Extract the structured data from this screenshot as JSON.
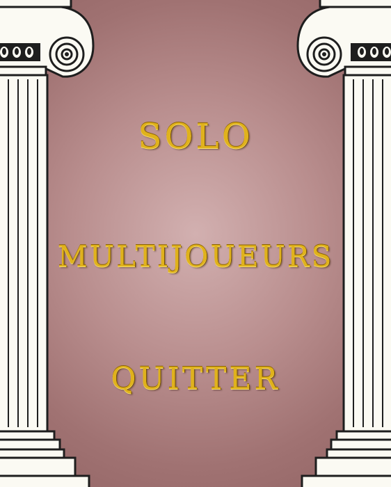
{
  "menu": {
    "solo": "SOLO",
    "multiplayer": "MULTIJOUEURS",
    "quit": "QUITTER"
  },
  "theme": {
    "background": "#b98e8e",
    "text_gold": "#e0b21c",
    "column_fill": "#fbfaf3",
    "column_outline": "#1e1e1e"
  },
  "decorations": {
    "left_column": "ionic-column-icon",
    "right_column": "ionic-column-icon"
  }
}
